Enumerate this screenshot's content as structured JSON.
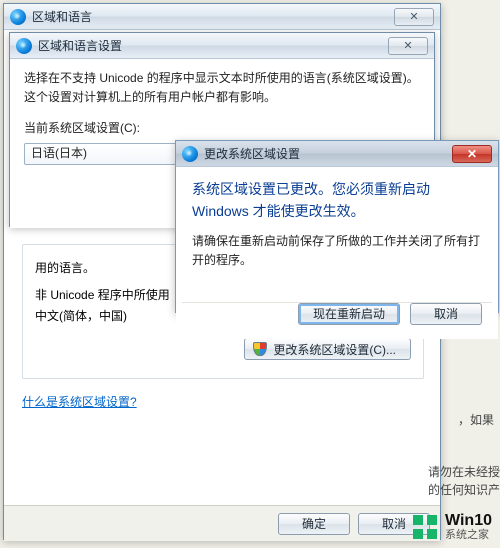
{
  "parent_window": {
    "title": "区域和语言",
    "close_glyph": "✕"
  },
  "settings_panel": {
    "title": "区域和语言设置",
    "close_glyph": "✕",
    "description": "选择在不支持 Unicode 的程序中显示文本时所使用的语言(系统区域设置)。这个设置对计算机上的所有用户帐户都有影响。",
    "current_locale_label": "当前系统区域设置(C):",
    "combo_value": "日语(日本)",
    "group_line_used": "用的语言。",
    "group_non_unicode": "非 Unicode 程序中所使用",
    "group_non_unicode_value": "中文(简体，中国)",
    "change_locale_btn": "更改系统区域设置(C)...",
    "help_link": "什么是系统区域设置?",
    "ok": "确定",
    "cancel": "取消"
  },
  "dialog": {
    "title": "更改系统区域设置",
    "close_glyph": "✕",
    "headline": "系统区域设置已更改。您必须重新启动 Windows 才能使更改生效。",
    "body": "请确保在重新启动前保存了所做的工作并关闭了所有打开的程序。",
    "restart_now": "现在重新启动",
    "cancel": "取消"
  },
  "background": {
    "hint_right_1": "，如果",
    "hint_right_2": "请勿在未经授",
    "hint_right_3": "的任何知识产"
  },
  "brand": {
    "name": "Win10",
    "sub": "系统之家"
  }
}
